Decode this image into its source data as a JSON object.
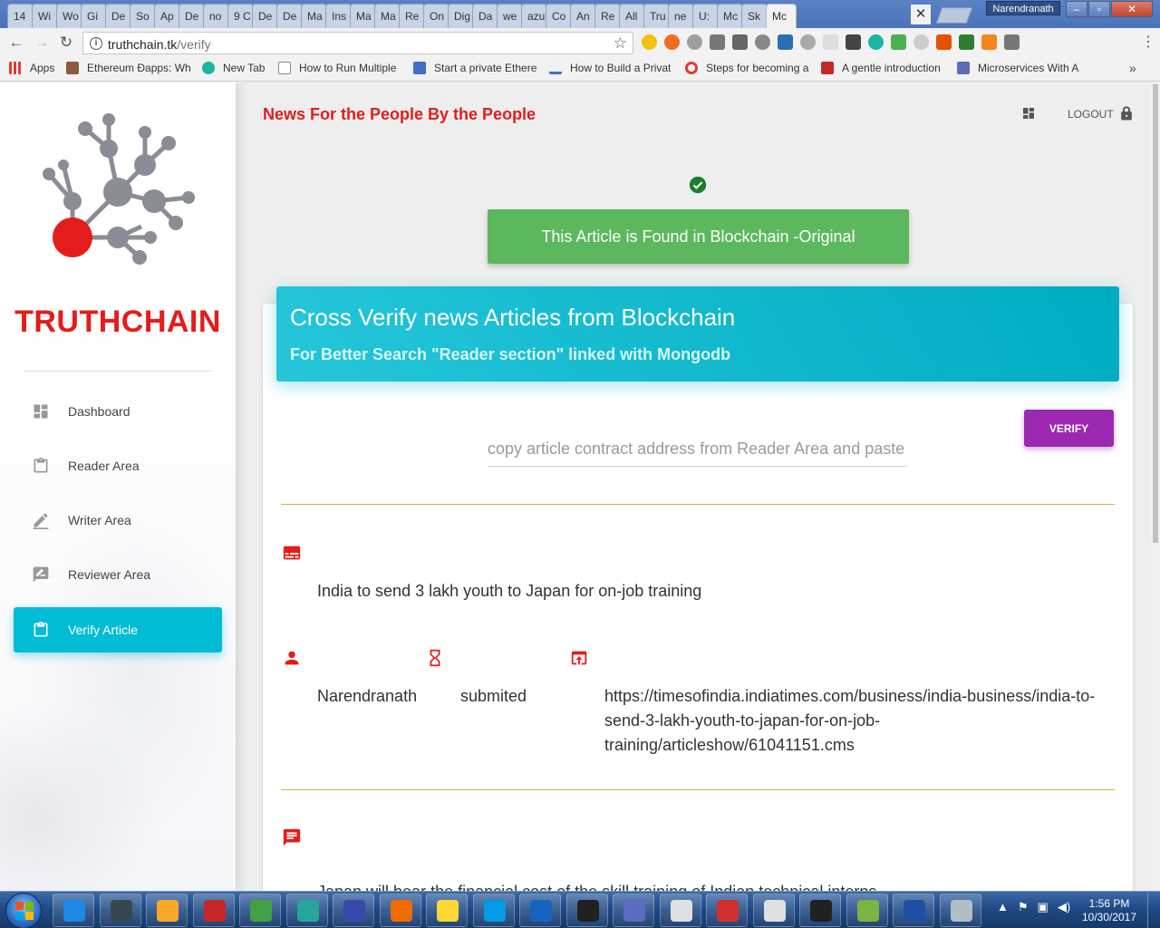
{
  "browser": {
    "tabs": [
      "14",
      "Wi",
      "Wo",
      "Gi",
      "De",
      "So",
      "Ap",
      "De",
      "no",
      "9 C",
      "De",
      "De",
      "Ma",
      "Ins",
      "Ma",
      "Ma",
      "Re",
      "On",
      "Dig",
      "Da",
      "we",
      "azu",
      "Co",
      "An",
      "Re",
      "All",
      "Tru",
      "ne",
      "U:",
      "Mc",
      "Sk",
      "Mc"
    ],
    "active_tab_index": 31,
    "profile_name": "Narendranath",
    "url_host": "truthchain.tk",
    "url_path": "/verify",
    "bookmarks": [
      {
        "label": "Apps",
        "icon": "apps-grid-icon",
        "color": "#e53935"
      },
      {
        "label": "Ethereum Ðapps: Wh",
        "icon": "briefcase-icon",
        "color": "#8d5b3b"
      },
      {
        "label": "New Tab",
        "icon": "m-circle-icon",
        "color": "#1ab7a4"
      },
      {
        "label": "How to Run Multiple",
        "icon": "page-icon",
        "color": "#ffffff"
      },
      {
        "label": "Start a private Ethere",
        "icon": "cap-icon",
        "color": "#3f6fc6"
      },
      {
        "label": "How to Build a Privat",
        "icon": "bookmark-icon",
        "color": "#f0f0f0"
      },
      {
        "label": "Steps for becoming a",
        "icon": "c-circle-icon",
        "color": "#e53935"
      },
      {
        "label": "A gentle introduction",
        "icon": "cube-icon",
        "color": "#c62828"
      },
      {
        "label": "Microservices With A",
        "icon": "graph-icon",
        "color": "#5e6bb5"
      }
    ]
  },
  "app": {
    "brand": "TRUTHCHAIN",
    "headline": "News For the People By the People",
    "logout_label": "LOGOUT",
    "nav": [
      {
        "label": "Dashboard",
        "icon": "dashboard-icon",
        "active": false
      },
      {
        "label": "Reader Area",
        "icon": "clipboard-icon",
        "active": false
      },
      {
        "label": "Writer Area",
        "icon": "pencil-icon",
        "active": false
      },
      {
        "label": "Reviewer Area",
        "icon": "rate-review-icon",
        "active": false
      },
      {
        "label": "Verify Article",
        "icon": "clipboard-icon",
        "active": true
      }
    ],
    "alert_text": "This Article is Found in Blockchain -Original",
    "card_title": "Cross Verify news Articles from Blockchain",
    "card_subtitle": "For Better Search \"Reader section\" linked with Mongodb",
    "address_placeholder": "copy article contract address from Reader Area and paste",
    "verify_label": "VERIFY",
    "result": {
      "title": "India to send 3 lakh youth to Japan for on-job training",
      "author": "Narendranath",
      "status": "submited",
      "url_line1": "https://timesofindia.indiatimes.com/business/india-business/india-to-",
      "url_line2": "send-3-lakh-youth-to-japan-for-on-job-",
      "url_line3": "training/articleshow/61041151.cms",
      "body_preview": "Japan will bear the financial cost of the skill training of Indian technical interns"
    }
  },
  "colors": {
    "brand_red": "#e41c1c",
    "accent_cyan": "#00bcd4",
    "success_green": "#5cb85c",
    "verify_purple": "#9c27b0",
    "rule_gold": "#d4b63a"
  },
  "taskbar": {
    "apps": [
      "ie-icon",
      "tree-icon",
      "folder-icon",
      "swirl-icon",
      "chrome-icon",
      "atom-icon",
      "eclipse-icon",
      "postman-icon",
      "notes-icon",
      "skype-icon",
      "outlook-icon",
      "cmd-icon",
      "tools-icon",
      "java-icon",
      "pdf-icon",
      "java-icon",
      "cmd-icon",
      "notepadpp-icon",
      "word-icon",
      "snipping-icon"
    ],
    "time": "1:56 PM",
    "date": "10/30/2017"
  }
}
